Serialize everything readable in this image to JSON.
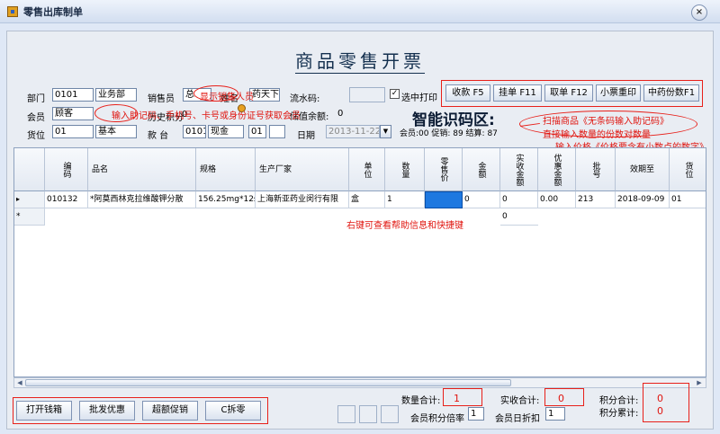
{
  "window": {
    "title": "零售出库制单",
    "close_label": "×"
  },
  "heading": "商品零售开票",
  "form": {
    "dept_label": "部门",
    "dept_code": "0101",
    "dept_name": "业务部",
    "salesman_label": "销售员",
    "salesman_value": "总",
    "name_label": "姓名",
    "name_value": "药天下",
    "serial_label": "流水码:",
    "serial_value": "",
    "print_check_label": "选中打印",
    "print_checked": true,
    "member_label": "会员",
    "member_value": "顾客",
    "history_label": "历史积分",
    "history_value": "0",
    "points_label": "储值余额:",
    "points_value": "0",
    "location_label": "货位",
    "location_code": "01",
    "location_name": "基本",
    "counter_label": "款 台",
    "counter_code": "0101",
    "counter_name": "现金",
    "counter_extra": "01",
    "date_label": "日期",
    "date_value": "2013-11-22"
  },
  "toolbar": {
    "buttons": [
      "收款 F5",
      "挂单 F11",
      "取单 F12",
      "小票重印",
      "中药份数F1"
    ]
  },
  "smart": {
    "title": "智能识码区:",
    "stats": "会员:00 促销: 89 结算: 87"
  },
  "annotations": {
    "salesman": "显示销售人员",
    "member": "输入助记码、手机号、卡号或身份证号获取会员",
    "scan_line1": "扫描商品《无条码输入助记码》",
    "scan_line2": "直接输入数量的份数对数量",
    "scan_line3": "输入价格《价格要含有小数点的数字》",
    "rightclick": "右键可查看帮助信息和快捷键"
  },
  "grid": {
    "columns": [
      "编码",
      "品名",
      "规格",
      "生产厂家",
      "单位",
      "数量",
      "零售价",
      "金额",
      "实收金额",
      "优惠金额",
      "批号",
      "效期至",
      "货位"
    ],
    "row": [
      "010132",
      "*阿莫西林克拉维酸钾分散",
      "156.25mg*12s",
      "上海新亚药业闵行有限",
      "盒",
      "1",
      "",
      "0",
      "0",
      "0.00",
      "213",
      "2018-09-09",
      "01"
    ],
    "new_row_marker": "*",
    "current_row_marker": "▸",
    "new_row_amount": "0"
  },
  "footer": {
    "buttons": [
      "打开钱箱",
      "批发优惠",
      "超额促销",
      "C拆零"
    ],
    "qty_total_label": "数量合计:",
    "qty_total": "1",
    "paid_total_label": "实收合计:",
    "paid_total": "0",
    "points_total_label": "积分合计:",
    "points_total": "0",
    "points_accum_label": "积分累计:",
    "points_accum": "0",
    "member_rate_label": "会员积分倍率",
    "member_rate": "1",
    "member_discount_label": "会员日折扣",
    "member_discount": "1"
  },
  "colors": {
    "accent_red": "#e8201a",
    "selected_cell": "#1e78e0"
  }
}
